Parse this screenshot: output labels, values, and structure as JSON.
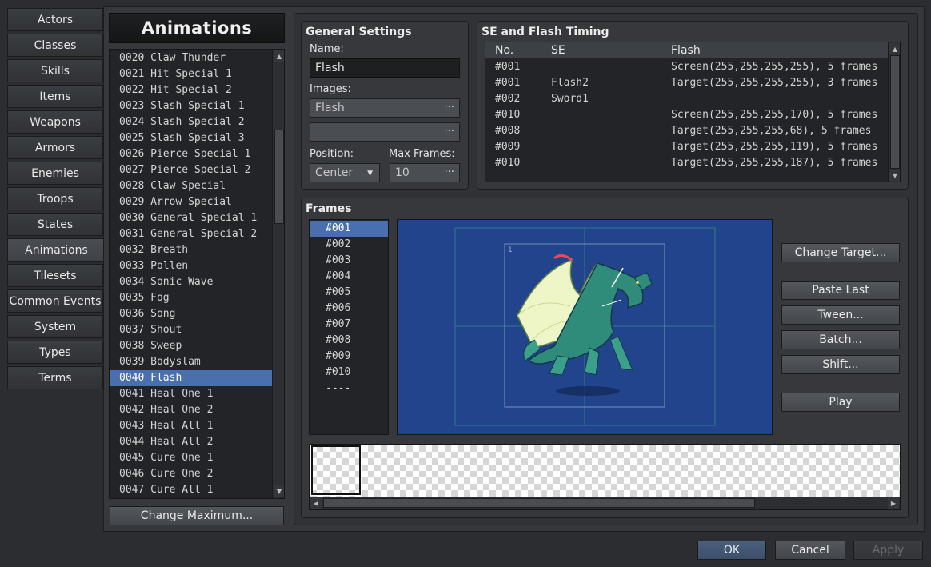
{
  "tabs": [
    {
      "label": "Actors"
    },
    {
      "label": "Classes"
    },
    {
      "label": "Skills"
    },
    {
      "label": "Items"
    },
    {
      "label": "Weapons"
    },
    {
      "label": "Armors"
    },
    {
      "label": "Enemies"
    },
    {
      "label": "Troops"
    },
    {
      "label": "States"
    },
    {
      "label": "Animations"
    },
    {
      "label": "Tilesets"
    },
    {
      "label": "Common Events"
    },
    {
      "label": "System"
    },
    {
      "label": "Types"
    },
    {
      "label": "Terms"
    }
  ],
  "active_tab": "Animations",
  "list": {
    "title": "Animations",
    "items": [
      "0020 Claw Thunder",
      "0021 Hit Special 1",
      "0022 Hit Special 2",
      "0023 Slash Special 1",
      "0024 Slash Special 2",
      "0025 Slash Special 3",
      "0026 Pierce Special 1",
      "0027 Pierce Special 2",
      "0028 Claw Special",
      "0029 Arrow Special",
      "0030 General Special 1",
      "0031 General Special 2",
      "0032 Breath",
      "0033 Pollen",
      "0034 Sonic Wave",
      "0035 Fog",
      "0036 Song",
      "0037 Shout",
      "0038 Sweep",
      "0039 Bodyslam",
      "0040 Flash",
      "0041 Heal One 1",
      "0042 Heal One 2",
      "0043 Heal All 1",
      "0044 Heal All 2",
      "0045 Cure One 1",
      "0046 Cure One 2",
      "0047 Cure All 1"
    ],
    "selected_index": 20,
    "change_max_label": "Change Maximum..."
  },
  "general": {
    "title": "General Settings",
    "name_label": "Name:",
    "name_value": "Flash",
    "images_label": "Images:",
    "image1": "Flash",
    "image2": "",
    "dots": "···",
    "position_label": "Position:",
    "position_value": "Center",
    "max_frames_label": "Max Frames:",
    "max_frames_value": "10"
  },
  "se_timing": {
    "title": "SE and Flash Timing",
    "headers": [
      "No.",
      "SE",
      "Flash"
    ],
    "rows": [
      {
        "no": "#001",
        "se": "",
        "flash": "Screen(255,255,255,255), 5 frames"
      },
      {
        "no": "#001",
        "se": "Flash2",
        "flash": "Target(255,255,255,255), 3 frames"
      },
      {
        "no": "#002",
        "se": "Sword1",
        "flash": ""
      },
      {
        "no": "#010",
        "se": "",
        "flash": "Screen(255,255,255,170), 5 frames"
      },
      {
        "no": "#008",
        "se": "",
        "flash": "Target(255,255,255,68), 5 frames"
      },
      {
        "no": "#009",
        "se": "",
        "flash": "Target(255,255,255,119), 5 frames"
      },
      {
        "no": "#010",
        "se": "",
        "flash": "Target(255,255,255,187), 5 frames"
      }
    ]
  },
  "frames": {
    "title": "Frames",
    "items": [
      "#001",
      "#002",
      "#003",
      "#004",
      "#005",
      "#006",
      "#007",
      "#008",
      "#009",
      "#010",
      "----"
    ],
    "selected_index": 0,
    "cell_number": "1",
    "buttons": {
      "change_target": "Change Target...",
      "paste_last": "Paste Last",
      "tween": "Tween...",
      "batch": "Batch...",
      "shift": "Shift...",
      "play": "Play"
    }
  },
  "dialog": {
    "ok": "OK",
    "cancel": "Cancel",
    "apply": "Apply"
  },
  "colors": {
    "selection": "#4a6fae",
    "canvas_bg": "#22448c"
  }
}
